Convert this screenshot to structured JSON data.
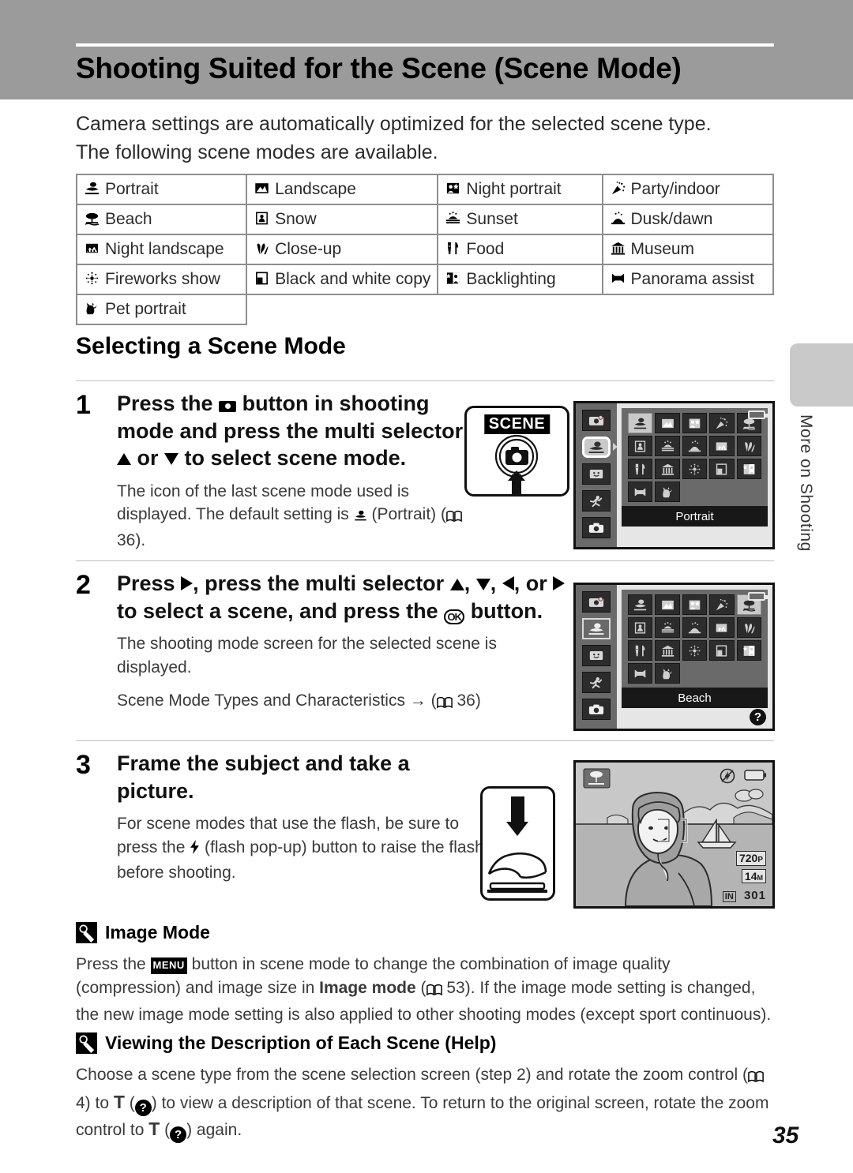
{
  "header": {
    "title": "Shooting Suited for the Scene (Scene Mode)"
  },
  "intro": "Camera settings are automatically optimized for the selected scene type. The following scene modes are available.",
  "scene_table": {
    "rows": [
      [
        {
          "icon": "portrait-icon",
          "label": "Portrait"
        },
        {
          "icon": "landscape-icon",
          "label": "Landscape"
        },
        {
          "icon": "night-portrait-icon",
          "label": "Night portrait"
        },
        {
          "icon": "party-indoor-icon",
          "label": "Party/indoor"
        }
      ],
      [
        {
          "icon": "beach-icon",
          "label": "Beach"
        },
        {
          "icon": "snow-icon",
          "label": "Snow"
        },
        {
          "icon": "sunset-icon",
          "label": "Sunset"
        },
        {
          "icon": "dusk-dawn-icon",
          "label": "Dusk/dawn"
        }
      ],
      [
        {
          "icon": "night-landscape-icon",
          "label": "Night landscape"
        },
        {
          "icon": "close-up-icon",
          "label": "Close-up"
        },
        {
          "icon": "food-icon",
          "label": "Food"
        },
        {
          "icon": "museum-icon",
          "label": "Museum"
        }
      ],
      [
        {
          "icon": "fireworks-icon",
          "label": "Fireworks show"
        },
        {
          "icon": "bw-copy-icon",
          "label": "Black and white copy"
        },
        {
          "icon": "backlighting-icon",
          "label": "Backlighting"
        },
        {
          "icon": "panorama-assist-icon",
          "label": "Panorama assist"
        }
      ],
      [
        {
          "icon": "pet-portrait-icon",
          "label": "Pet portrait"
        }
      ]
    ]
  },
  "section": {
    "heading": "Selecting a Scene Mode"
  },
  "steps": [
    {
      "number": "1",
      "title_parts": {
        "a": "Press the ",
        "b": " button in shooting mode and press the multi selector ",
        "c": " or ",
        "d": " to select scene mode."
      },
      "body_parts": {
        "a": "The icon of the last scene mode used is displayed. The default setting is ",
        "b": " (Portrait) (",
        "c": " 36)."
      },
      "illustration": {
        "button_badge": "SCENE",
        "button_icon": "camera-icon",
        "arrow": "up-arrow-icon"
      },
      "screen": {
        "label": "Portrait",
        "selected_index": 0,
        "has_help_badge": false
      }
    },
    {
      "number": "2",
      "title_parts": {
        "a": "Press ",
        "b": ", press the multi selector ",
        "c": ", ",
        "d": ", ",
        "e": ", or ",
        "f": " to select a scene, and press the ",
        "g": " button."
      },
      "body_text": "The shooting mode screen for the selected scene is displayed.",
      "ref_parts": {
        "a": "Scene Mode Types and Characteristics → (",
        "b": " 36)"
      },
      "screen": {
        "label": "Beach",
        "selected_index": 4,
        "has_help_badge": true
      }
    },
    {
      "number": "3",
      "title": "Frame the subject and take a picture.",
      "body_parts": {
        "a": "For scene modes that use the flash, be sure to press the ",
        "b": " (flash pop-up) button to raise the flash before shooting."
      },
      "illustration": {
        "arrow": "down-arrow-icon",
        "hand": "finger-press-icon"
      },
      "photo": {
        "mode_badge": "beach-icon",
        "flash_off_icon": "flash-off-icon",
        "battery_icon": "battery-icon",
        "movie_res": "720",
        "movie_res_suffix": "P",
        "image_size": "14",
        "image_size_suffix": "M",
        "storage_icon": "IN",
        "shots_remaining": "301"
      }
    }
  ],
  "notes": [
    {
      "badge": "note-pencil-icon",
      "title": "Image Mode",
      "body_parts": {
        "a": "Press the ",
        "b": "MENU",
        "c": " button in scene mode to change the combination of image quality (compression) and image size in ",
        "d": "Image mode",
        "e": " (",
        "f": " 53). If the image mode setting is changed, the new image mode setting is also applied to other shooting modes (except sport continuous)."
      }
    },
    {
      "badge": "note-pencil-icon",
      "title": "Viewing the Description of Each Scene (Help)",
      "body_parts": {
        "a": "Choose a scene type from the scene selection screen (step 2) and rotate the zoom control (",
        "b": " 4) to ",
        "c": "T",
        "d": " (",
        "e": ") to view a description of that scene. To return to the original screen, rotate the zoom control to ",
        "f": "T",
        "g": " (",
        "h": ") again."
      }
    }
  ],
  "side_tab": {
    "label": "More on Shooting"
  },
  "page_number": "35",
  "colors": {
    "header_band": "#9b9b9b",
    "side_tab": "#c9c9c9",
    "table_border": "#8e8e8e",
    "lcd_rail": "#6a6a6a",
    "lcd_icon": "#2c2c2c"
  }
}
